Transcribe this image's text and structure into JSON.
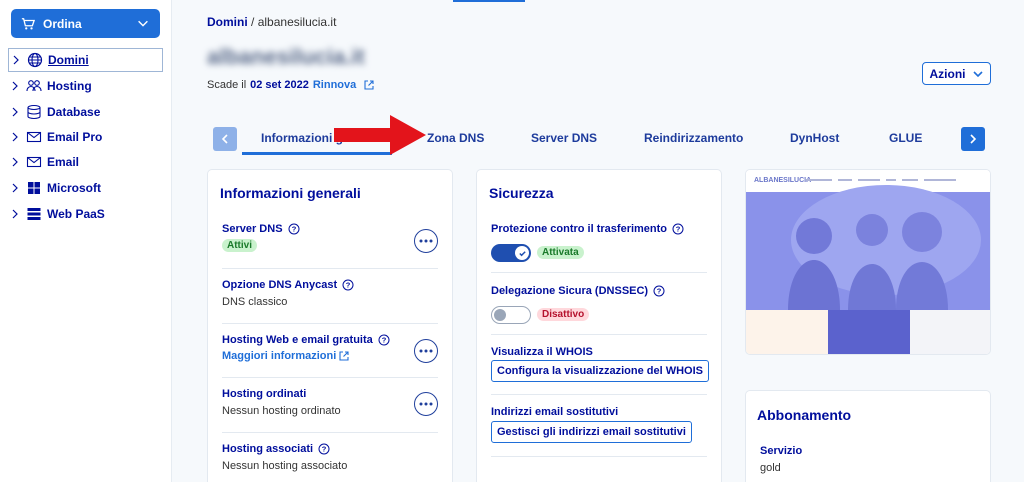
{
  "sidebar": {
    "order_label": "Ordina",
    "items": [
      {
        "label": "Domini",
        "icon": "globe-icon"
      },
      {
        "label": "Hosting",
        "icon": "people-icon"
      },
      {
        "label": "Database",
        "icon": "database-icon"
      },
      {
        "label": "Email Pro",
        "icon": "mail-icon"
      },
      {
        "label": "Email",
        "icon": "mail-icon"
      },
      {
        "label": "Microsoft",
        "icon": "microsoft-icon"
      },
      {
        "label": "Web PaaS",
        "icon": "stack-icon"
      }
    ]
  },
  "breadcrumb": {
    "root": "Domini",
    "sep": "/",
    "current": "albanesilucia.it"
  },
  "domain": {
    "title": "albanesilucia.it",
    "expiry_prefix": "Scade il",
    "expiry_date": "02 set 2022",
    "renew_label": "Rinnova"
  },
  "actions_label": "Azioni",
  "tabs": [
    "Informazioni g",
    "Zona DNS",
    "Server DNS",
    "Reindirizzamento",
    "DynHost",
    "GLUE"
  ],
  "general_info": {
    "title": "Informazioni generali",
    "rows": [
      {
        "label": "Server DNS",
        "badge": "Attivi"
      },
      {
        "label": "Opzione DNS Anycast",
        "value": "DNS classico"
      },
      {
        "label": "Hosting Web e email gratuita",
        "link": "Maggiori informazioni"
      },
      {
        "label": "Hosting ordinati",
        "value": "Nessun hosting ordinato"
      },
      {
        "label": "Hosting associati",
        "value": "Nessun hosting associato"
      }
    ]
  },
  "security": {
    "title": "Sicurezza",
    "transfer_label": "Protezione contro il trasferimento",
    "transfer_state": "Attivata",
    "dnssec_label": "Delegazione Sicura (DNSSEC)",
    "dnssec_state": "Disattivo",
    "whois_label": "Visualizza il WHOIS",
    "whois_button": "Configura la visualizzazione del WHOIS",
    "email_label": "Indirizzi email sostitutivi",
    "email_button": "Gestisci gli indirizzi email sostitutivi"
  },
  "preview": {
    "site_name": "ALBANESILUCIA"
  },
  "subscription": {
    "title": "Abbonamento",
    "service_label": "Servizio",
    "service_value": "gold"
  },
  "colors": {
    "accent": "#1f6ed8",
    "text": "#000e9c",
    "arrow": "#e3141b"
  }
}
